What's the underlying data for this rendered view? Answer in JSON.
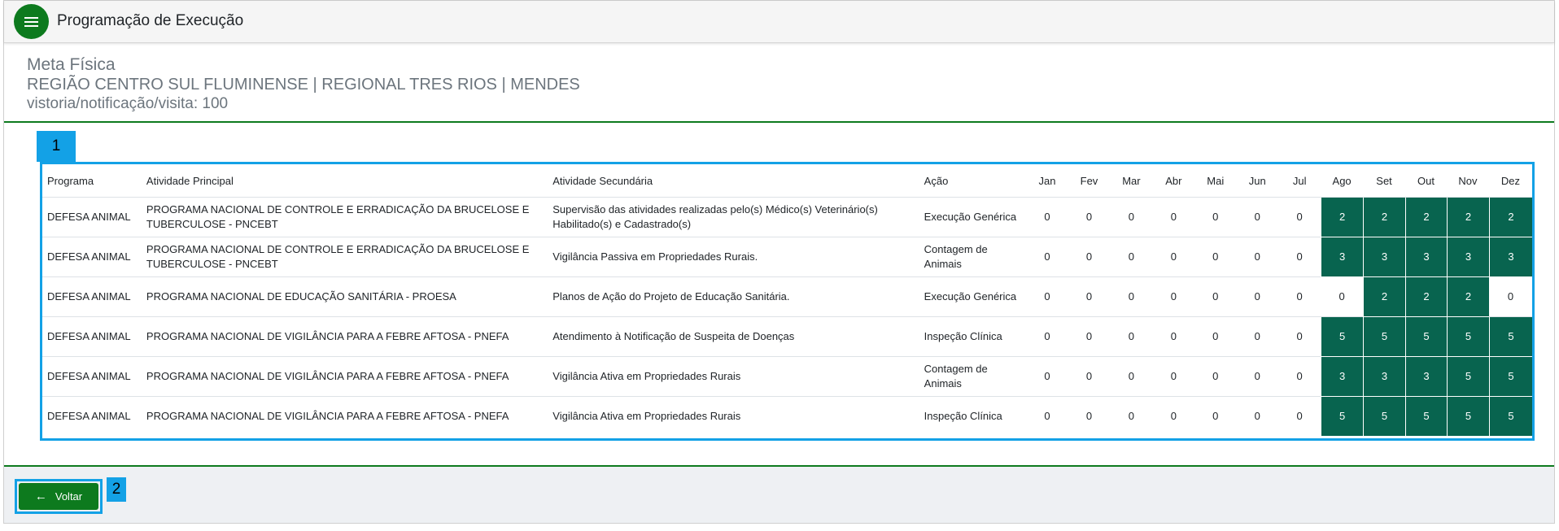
{
  "app": {
    "title": "Programação de Execução",
    "menu_icon": "menu-icon"
  },
  "header": {
    "title": "Meta Física",
    "location": "REGIÃO CENTRO SUL FLUMINENSE | REGIONAL TRES RIOS | MENDES",
    "target": "vistoria/notificação/visita: 100"
  },
  "callouts": {
    "table": "1",
    "back": "2"
  },
  "colors": {
    "primary": "#0d7a1e",
    "highlight": "#08644f",
    "callout": "#13a1e6"
  },
  "table": {
    "columns": [
      "Programa",
      "Atividade Principal",
      "Atividade Secundária",
      "Ação",
      "Jan",
      "Fev",
      "Mar",
      "Abr",
      "Mai",
      "Jun",
      "Jul",
      "Ago",
      "Set",
      "Out",
      "Nov",
      "Dez"
    ],
    "rows": [
      {
        "programa": "DEFESA ANIMAL",
        "principal": "PROGRAMA NACIONAL DE CONTROLE E ERRADICAÇÃO DA BRUCELOSE E TUBERCULOSE - PNCEBT",
        "secundaria": "Supervisão das atividades realizadas pelo(s) Médico(s) Veterinário(s) Habilitado(s) e Cadastrado(s)",
        "acao": "Execução Genérica",
        "months": [
          "0",
          "0",
          "0",
          "0",
          "0",
          "0",
          "0",
          "2",
          "2",
          "2",
          "2",
          "2"
        ],
        "highlight": [
          false,
          false,
          false,
          false,
          false,
          false,
          false,
          true,
          true,
          true,
          true,
          true
        ]
      },
      {
        "programa": "DEFESA ANIMAL",
        "principal": "PROGRAMA NACIONAL DE CONTROLE E ERRADICAÇÃO DA BRUCELOSE E TUBERCULOSE - PNCEBT",
        "secundaria": "Vigilância Passiva em Propriedades Rurais.",
        "acao": "Contagem de Animais",
        "months": [
          "0",
          "0",
          "0",
          "0",
          "0",
          "0",
          "0",
          "3",
          "3",
          "3",
          "3",
          "3"
        ],
        "highlight": [
          false,
          false,
          false,
          false,
          false,
          false,
          false,
          true,
          true,
          true,
          true,
          true
        ]
      },
      {
        "programa": "DEFESA ANIMAL",
        "principal": "PROGRAMA NACIONAL DE EDUCAÇÃO SANITÁRIA - PROESA",
        "secundaria": "Planos de Ação do Projeto de Educação Sanitária.",
        "acao": "Execução Genérica",
        "months": [
          "0",
          "0",
          "0",
          "0",
          "0",
          "0",
          "0",
          "0",
          "2",
          "2",
          "2",
          "0"
        ],
        "highlight": [
          false,
          false,
          false,
          false,
          false,
          false,
          false,
          false,
          true,
          true,
          true,
          false
        ]
      },
      {
        "programa": "DEFESA ANIMAL",
        "principal": "PROGRAMA NACIONAL DE VIGILÂNCIA PARA A FEBRE AFTOSA - PNEFA",
        "secundaria": "Atendimento à Notificação de Suspeita de Doenças",
        "acao": "Inspeção Clínica",
        "months": [
          "0",
          "0",
          "0",
          "0",
          "0",
          "0",
          "0",
          "5",
          "5",
          "5",
          "5",
          "5"
        ],
        "highlight": [
          false,
          false,
          false,
          false,
          false,
          false,
          false,
          true,
          true,
          true,
          true,
          true
        ]
      },
      {
        "programa": "DEFESA ANIMAL",
        "principal": "PROGRAMA NACIONAL DE VIGILÂNCIA PARA A FEBRE AFTOSA - PNEFA",
        "secundaria": "Vigilância Ativa em Propriedades Rurais",
        "acao": "Contagem de Animais",
        "months": [
          "0",
          "0",
          "0",
          "0",
          "0",
          "0",
          "0",
          "3",
          "3",
          "3",
          "5",
          "5"
        ],
        "highlight": [
          false,
          false,
          false,
          false,
          false,
          false,
          false,
          true,
          true,
          true,
          true,
          true
        ]
      },
      {
        "programa": "DEFESA ANIMAL",
        "principal": "PROGRAMA NACIONAL DE VIGILÂNCIA PARA A FEBRE AFTOSA - PNEFA",
        "secundaria": "Vigilância Ativa em Propriedades Rurais",
        "acao": "Inspeção Clínica",
        "months": [
          "0",
          "0",
          "0",
          "0",
          "0",
          "0",
          "0",
          "5",
          "5",
          "5",
          "5",
          "5"
        ],
        "highlight": [
          false,
          false,
          false,
          false,
          false,
          false,
          false,
          true,
          true,
          true,
          true,
          true
        ]
      }
    ]
  },
  "footer": {
    "back_label": "Voltar",
    "back_icon": "arrow-left-icon"
  }
}
